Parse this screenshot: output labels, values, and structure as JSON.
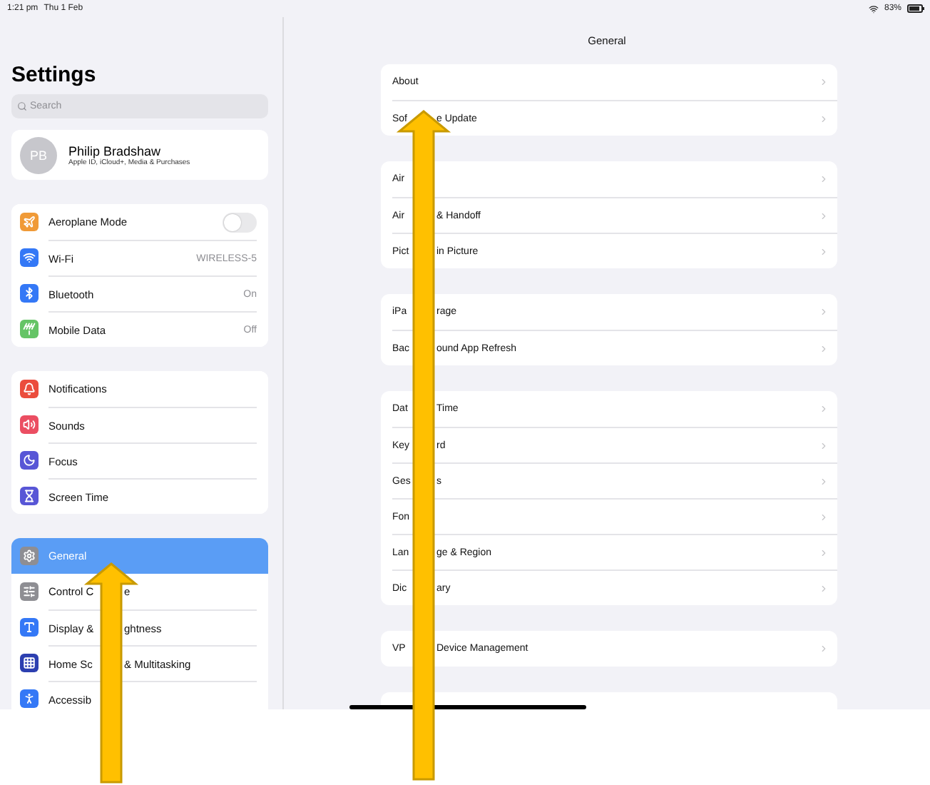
{
  "status_bar": {
    "time": "1:21 pm",
    "date": "Thu 1 Feb",
    "battery": "83%"
  },
  "sidebar": {
    "title": "Settings",
    "search": {
      "placeholder": "Search"
    },
    "profile": {
      "initials": "PB",
      "name": "Philip Bradshaw",
      "subtitle": "Apple ID, iCloud+, Media & Purchases"
    },
    "groups": [
      {
        "items": [
          {
            "parts": [
              "Aeroplane Mode"
            ],
            "kind": "toggle",
            "on": false,
            "color": "#f09a37",
            "selected": false
          },
          {
            "parts": [
              "Wi-Fi"
            ],
            "kind": "value",
            "value": "WIRELESS-5",
            "color": "#3478f6",
            "selected": false
          },
          {
            "parts": [
              "Bluetooth"
            ],
            "kind": "value",
            "value": "On",
            "color": "#3478f6",
            "selected": false
          },
          {
            "parts": [
              "Mobile Data"
            ],
            "kind": "value",
            "value": "Off",
            "color": "#65c466",
            "selected": false
          }
        ]
      },
      {
        "items": [
          {
            "parts": [
              "Notifications"
            ],
            "kind": "link",
            "color": "#eb4d3d",
            "selected": false
          },
          {
            "parts": [
              "Sounds"
            ],
            "kind": "link",
            "color": "#eb4e62",
            "selected": false
          },
          {
            "parts": [
              "Focus"
            ],
            "kind": "link",
            "color": "#5856d6",
            "selected": false
          },
          {
            "parts": [
              "Screen Time"
            ],
            "kind": "link",
            "color": "#5856d6",
            "selected": false
          }
        ]
      },
      {
        "items": [
          {
            "parts": [
              "General"
            ],
            "kind": "link",
            "color": "#8e8e93",
            "selected": true
          },
          {
            "parts": [
              "Control C",
              "e"
            ],
            "kind": "link",
            "color": "#8e8e93",
            "selected": false
          },
          {
            "parts": [
              "Display &",
              "ghtness"
            ],
            "kind": "link",
            "color": "#3478f6",
            "selected": false
          },
          {
            "parts": [
              "Home Sc",
              "& Multitasking"
            ],
            "kind": "link",
            "color": "#2c3fb0",
            "selected": false
          },
          {
            "parts": [
              "Accessib"
            ],
            "kind": "link",
            "color": "#3478f6",
            "selected": false
          }
        ]
      }
    ]
  },
  "detail": {
    "title": "General",
    "groups": [
      {
        "items": [
          {
            "parts": [
              "About"
            ]
          },
          {
            "parts": [
              "Sof",
              "e Update"
            ]
          }
        ]
      },
      {
        "items": [
          {
            "parts": [
              "Air"
            ]
          },
          {
            "parts": [
              "Air",
              "& Handoff"
            ]
          },
          {
            "parts": [
              "Pict",
              "in Picture"
            ]
          }
        ]
      },
      {
        "items": [
          {
            "parts": [
              "iPa",
              "rage"
            ]
          },
          {
            "parts": [
              "Bac",
              "ound App Refresh"
            ]
          }
        ]
      },
      {
        "items": [
          {
            "parts": [
              "Dat",
              "Time"
            ]
          },
          {
            "parts": [
              "Key",
              "rd"
            ]
          },
          {
            "parts": [
              "Ges",
              "s"
            ]
          },
          {
            "parts": [
              "Fon"
            ]
          },
          {
            "parts": [
              "Lan",
              "ge & Region"
            ]
          },
          {
            "parts": [
              "Dic",
              "ary"
            ]
          }
        ]
      },
      {
        "items": [
          {
            "parts": [
              "VP",
              "Device Management"
            ]
          }
        ]
      }
    ]
  }
}
